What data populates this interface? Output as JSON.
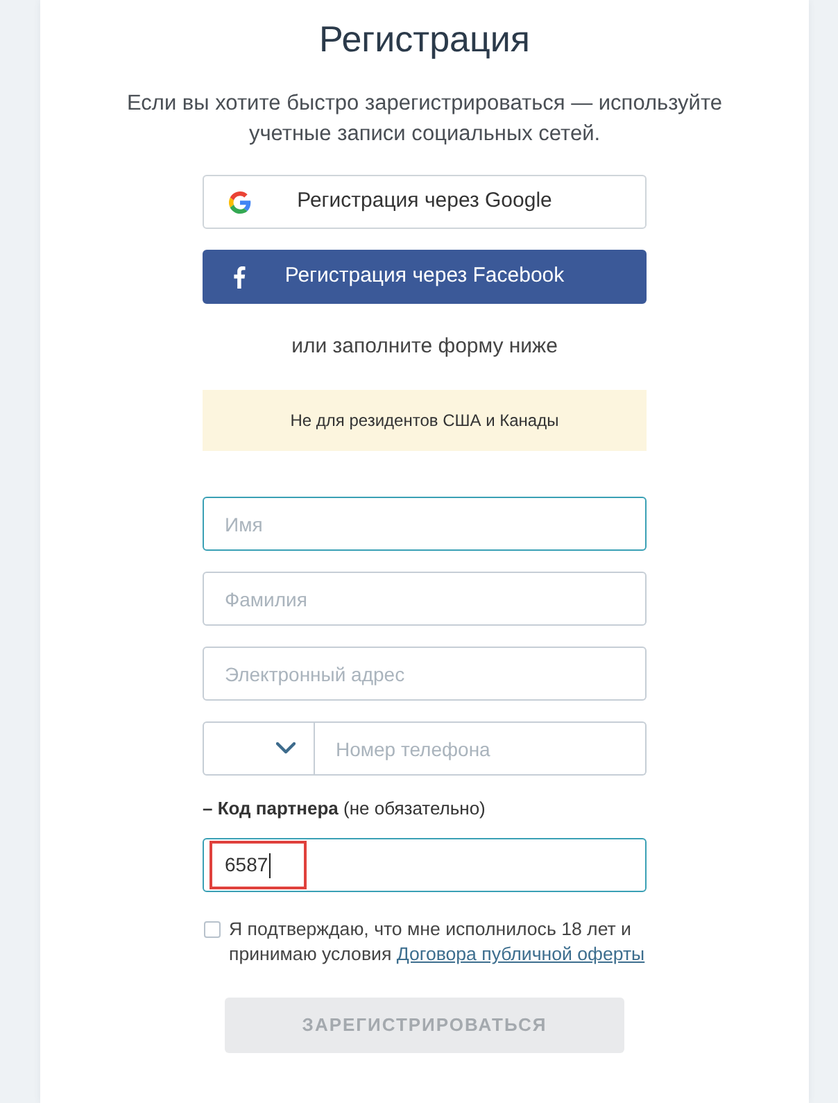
{
  "title": "Регистрация",
  "subtitle": "Если вы хотите быстро зарегистрироваться — используйте учетные записи социальных сетей.",
  "social_buttons": [
    {
      "kind": "google",
      "label": "Регистрация через Google"
    },
    {
      "kind": "facebook",
      "label": "Регистрация через Facebook"
    }
  ],
  "divider_text": "или заполните форму ниже",
  "notice": "Не для резидентов США и Канады",
  "fields": [
    {
      "kind": "text",
      "placeholder": "Имя",
      "active": true
    },
    {
      "kind": "text",
      "placeholder": "Фамилия",
      "active": false
    },
    {
      "kind": "text",
      "placeholder": "Электронный адрес",
      "active": false
    },
    {
      "kind": "phone",
      "placeholder": "Номер телефона",
      "active": false
    }
  ],
  "partner_code": {
    "label": "**– Код партнера** (не обязательно)",
    "value": "6587",
    "active": true,
    "caret": true,
    "marked": true
  },
  "agreement": {
    "text": "Я подтверждаю, что мне исполнилось 18 лет и принимаю условия",
    "link": "Договора публичной оферты",
    "checked": false
  },
  "submit": {
    "label": "ЗАРЕГИСТРИРОВАТЬСЯ",
    "disabled": true
  }
}
